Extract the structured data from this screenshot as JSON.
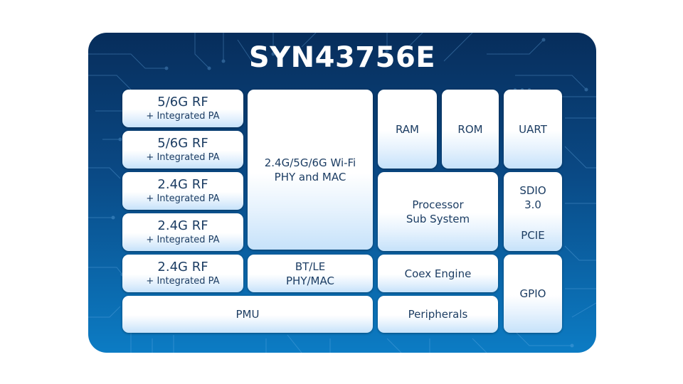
{
  "diagram": {
    "title": "SYN43756E",
    "colors": {
      "panel_top": "#072d5b",
      "panel_bottom": "#0c7cc4",
      "block_text": "#1c3d63",
      "title_text": "#ffffff"
    },
    "rf_blocks": [
      {
        "band": "5/6G RF",
        "detail": "+ Integrated PA"
      },
      {
        "band": "5/6G RF",
        "detail": "+ Integrated PA"
      },
      {
        "band": "2.4G RF",
        "detail": "+ Integrated PA"
      },
      {
        "band": "2.4G RF",
        "detail": "+ Integrated PA"
      },
      {
        "band": "2.4G RF",
        "detail": "+ Integrated PA"
      }
    ],
    "wifi": {
      "line1": "2.4G/5G/6G Wi-Fi",
      "line2": "PHY and MAC"
    },
    "bt": {
      "line1": "BT/LE",
      "line2": "PHY/MAC"
    },
    "pmu": "PMU",
    "ram": "RAM",
    "rom": "ROM",
    "uart": "UART",
    "processor": {
      "line1": "Processor",
      "line2": "Sub System"
    },
    "sdio": {
      "line1": "SDIO",
      "line2": "3.0",
      "line3": "PCIE"
    },
    "coex": "Coex Engine",
    "peripherals": "Peripherals",
    "gpio": "GPIO"
  }
}
